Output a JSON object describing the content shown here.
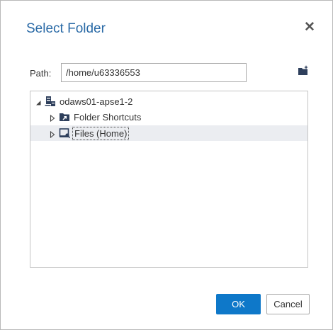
{
  "dialog": {
    "title": "Select Folder",
    "close_icon": "close-icon"
  },
  "path": {
    "label": "Path:",
    "value": "/home/u63336553"
  },
  "toolbar": {
    "new_folder_icon": "new-folder-icon"
  },
  "tree": {
    "root": {
      "label": "odaws01-apse1-2",
      "icon": "server-icon",
      "expanded": true
    },
    "children": [
      {
        "label": "Folder Shortcuts",
        "icon": "folder-shortcut-icon",
        "expanded": false
      },
      {
        "label": "Files (Home)",
        "icon": "home-folder-icon",
        "expanded": false,
        "selected": true
      }
    ]
  },
  "buttons": {
    "ok_label": "OK",
    "cancel_label": "Cancel"
  },
  "colors": {
    "title": "#2a6aa6",
    "primary_button": "#0e78c9",
    "selected_row": "#ebedf1"
  }
}
